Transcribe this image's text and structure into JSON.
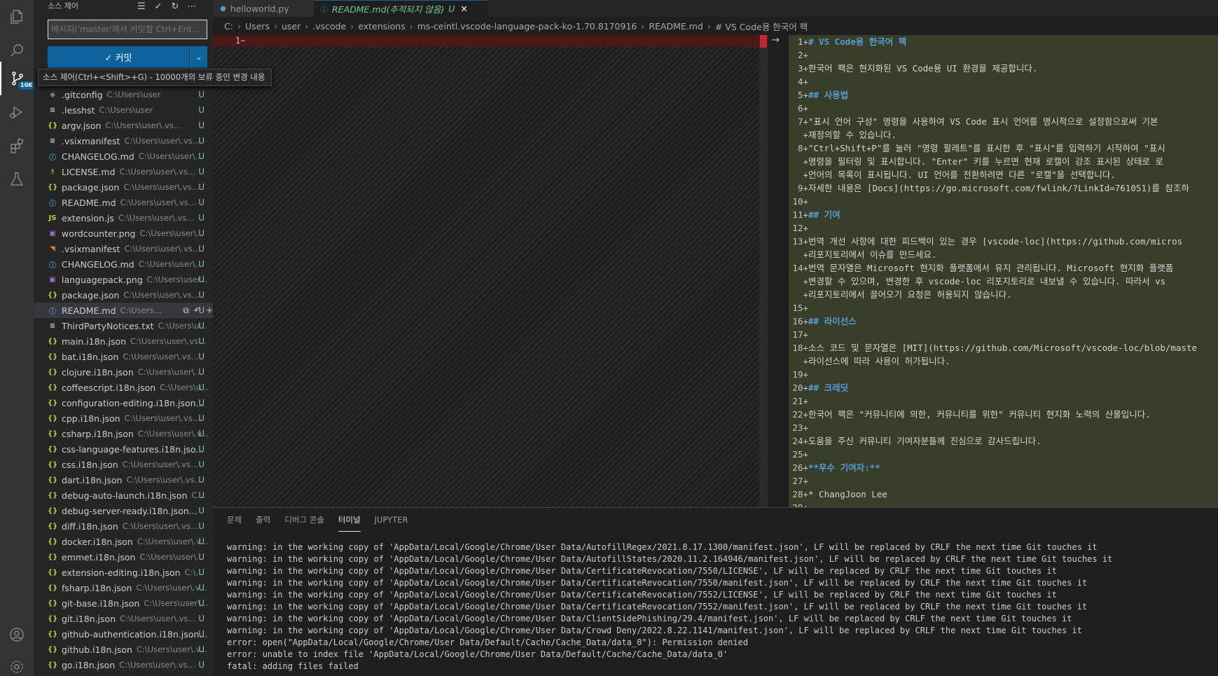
{
  "sidebar": {
    "title": "소스 제어",
    "commit_placeholder": "메시지('master'에서 커밋할 Ctrl+Ent...",
    "commit_label": "✓ 커밋",
    "tooltip": "소스 제어(Ctrl+<Shift>+G) - 10000개의 보류 중인 변경 내용",
    "badge": "10K",
    "files": [
      {
        "icon": "◆",
        "color": "#6d8086",
        "name": ".gitconfig",
        "path": "C:\\Users\\user",
        "status": "U"
      },
      {
        "icon": "≡",
        "color": "#ccc",
        "name": ".lesshst",
        "path": "C:\\Users\\user",
        "status": "U"
      },
      {
        "icon": "{}",
        "color": "#cbcb41",
        "name": "argv.json",
        "path": "C:\\Users\\user\\.vscode",
        "status": "U"
      },
      {
        "icon": "≡",
        "color": "#ccc",
        "name": ".vsixmanifest",
        "path": "C:\\Users\\user\\.vsco...",
        "status": "U"
      },
      {
        "icon": "ⓘ",
        "color": "#519aba",
        "name": "CHANGELOG.md",
        "path": "C:\\Users\\user\\...",
        "status": "U"
      },
      {
        "icon": "♗",
        "color": "#cbcb41",
        "name": "LICENSE.md",
        "path": "C:\\Users\\user\\.vscod...",
        "status": "U"
      },
      {
        "icon": "{}",
        "color": "#cbcb41",
        "name": "package.json",
        "path": "C:\\Users\\user\\.vsco...",
        "status": "U"
      },
      {
        "icon": "ⓘ",
        "color": "#519aba",
        "name": "README.md",
        "path": "C:\\Users\\user\\.vsco...",
        "status": "U"
      },
      {
        "icon": "JS",
        "color": "#cbcb41",
        "name": "extension.js",
        "path": "C:\\Users\\user\\.vscod...",
        "status": "U"
      },
      {
        "icon": "▣",
        "color": "#a074c4",
        "name": "wordcounter.png",
        "path": "C:\\Users\\user\\...",
        "status": "U"
      },
      {
        "icon": "◥",
        "color": "#e37933",
        "name": ".vsixmanifest",
        "path": "C:\\Users\\user\\.vsco...",
        "status": "U"
      },
      {
        "icon": "ⓘ",
        "color": "#519aba",
        "name": "CHANGELOG.md",
        "path": "C:\\Users\\user\\...",
        "status": "U"
      },
      {
        "icon": "▣",
        "color": "#a074c4",
        "name": "languagepack.png",
        "path": "C:\\Users\\user...",
        "status": "U"
      },
      {
        "icon": "{}",
        "color": "#cbcb41",
        "name": "package.json",
        "path": "C:\\Users\\user\\.vsco...",
        "status": "U"
      },
      {
        "icon": "ⓘ",
        "color": "#519aba",
        "name": "README.md",
        "path": "C:\\Users...",
        "status": "U",
        "selected": true
      },
      {
        "icon": "≡",
        "color": "#ccc",
        "name": "ThirdPartyNotices.txt",
        "path": "C:\\Users\\u...",
        "status": "U"
      },
      {
        "icon": "{}",
        "color": "#cbcb41",
        "name": "main.i18n.json",
        "path": "C:\\Users\\user\\.vsc...",
        "status": "U"
      },
      {
        "icon": "{}",
        "color": "#cbcb41",
        "name": "bat.i18n.json",
        "path": "C:\\Users\\user\\.vsco...",
        "status": "U"
      },
      {
        "icon": "{}",
        "color": "#cbcb41",
        "name": "clojure.i18n.json",
        "path": "C:\\Users\\user\\...",
        "status": "U"
      },
      {
        "icon": "{}",
        "color": "#cbcb41",
        "name": "coffeescript.i18n.json",
        "path": "C:\\Users\\u...",
        "status": "U"
      },
      {
        "icon": "{}",
        "color": "#cbcb41",
        "name": "configuration-editing.i18n.json...",
        "path": "",
        "status": "U"
      },
      {
        "icon": "{}",
        "color": "#cbcb41",
        "name": "cpp.i18n.json",
        "path": "C:\\Users\\user\\.vsco...",
        "status": "U"
      },
      {
        "icon": "{}",
        "color": "#cbcb41",
        "name": "csharp.i18n.json",
        "path": "C:\\Users\\user\\.v...",
        "status": "U"
      },
      {
        "icon": "{}",
        "color": "#cbcb41",
        "name": "css-language-features.i18n.jso...",
        "path": "",
        "status": "U"
      },
      {
        "icon": "{}",
        "color": "#cbcb41",
        "name": "css.i18n.json",
        "path": "C:\\Users\\user\\.vsco...",
        "status": "U"
      },
      {
        "icon": "{}",
        "color": "#cbcb41",
        "name": "dart.i18n.json",
        "path": "C:\\Users\\user\\.vsc...",
        "status": "U"
      },
      {
        "icon": "{}",
        "color": "#cbcb41",
        "name": "debug-auto-launch.i18n.json",
        "path": "C...",
        "status": "U"
      },
      {
        "icon": "{}",
        "color": "#cbcb41",
        "name": "debug-server-ready.i18n.json...",
        "path": "",
        "status": "U"
      },
      {
        "icon": "{}",
        "color": "#cbcb41",
        "name": "diff.i18n.json",
        "path": "C:\\Users\\user\\.vsco...",
        "status": "U"
      },
      {
        "icon": "{}",
        "color": "#cbcb41",
        "name": "docker.i18n.json",
        "path": "C:\\Users\\user\\.v...",
        "status": "U"
      },
      {
        "icon": "{}",
        "color": "#cbcb41",
        "name": "emmet.i18n.json",
        "path": "C:\\Users\\user\\...",
        "status": "U"
      },
      {
        "icon": "{}",
        "color": "#cbcb41",
        "name": "extension-editing.i18n.json",
        "path": "C:\\...",
        "status": "U"
      },
      {
        "icon": "{}",
        "color": "#cbcb41",
        "name": "fsharp.i18n.json",
        "path": "C:\\Users\\user\\.v...",
        "status": "U"
      },
      {
        "icon": "{}",
        "color": "#cbcb41",
        "name": "git-base.i18n.json",
        "path": "C:\\Users\\user\\...",
        "status": "U"
      },
      {
        "icon": "{}",
        "color": "#cbcb41",
        "name": "git.i18n.json",
        "path": "C:\\Users\\user\\.vscod...",
        "status": "U"
      },
      {
        "icon": "{}",
        "color": "#cbcb41",
        "name": "github-authentication.i18n.json...",
        "path": "",
        "status": "U"
      },
      {
        "icon": "{}",
        "color": "#cbcb41",
        "name": "github.i18n.json",
        "path": "C:\\Users\\user\\.v...",
        "status": "U"
      },
      {
        "icon": "{}",
        "color": "#cbcb41",
        "name": "go.i18n.json",
        "path": "C:\\Users\\user\\.vscod...",
        "status": "U"
      }
    ]
  },
  "tabs": [
    {
      "icon": "py",
      "name": "helloworld.py",
      "suffix": ""
    },
    {
      "icon": "ⓘ",
      "name": "README.md(추적되지 않음)",
      "suffix": "U"
    }
  ],
  "breadcrumb": [
    "C:",
    "Users",
    "user",
    ".vscode",
    "extensions",
    "ms-ceintl.vscode-language-pack-ko-1.70.8170916",
    "README.md",
    "# VS Code용 한국어 팩"
  ],
  "left_line": "1−",
  "code_lines": [
    {
      "n": "1+",
      "t": "# VS Code용 한국어 팩",
      "c": "h"
    },
    {
      "n": "2+",
      "t": ""
    },
    {
      "n": "3+",
      "t": "한국어 팩은 현지화된 VS Code용 UI 환경을 제공합니다."
    },
    {
      "n": "4+",
      "t": ""
    },
    {
      "n": "5+",
      "t": "## 사용법",
      "c": "h"
    },
    {
      "n": "6+",
      "t": ""
    },
    {
      "n": "7+",
      "t": "\"표시 언어 구성\" 명령을 사용하여 VS Code 표시 언어를 명시적으로 설정함으로써 기본"
    },
    {
      "n": "+",
      "t": "재정의할 수 있습니다."
    },
    {
      "n": "8+",
      "t": "\"Ctrl+Shift+P\"를 눌러 \"명령 팔레트\"를 표시한 후 \"표시\"를 입력하기 시작하여 \"표시"
    },
    {
      "n": "+",
      "t": "명령을 필터링 및 표시합니다. \"Enter\" 키를 누르면 현재 로캘이 강조 표시된 상태로 로"
    },
    {
      "n": "+",
      "t": "언어의 목록이 표시됩니다. UI 언어를 전환하려면 다른 \"로캘\"을 선택합니다."
    },
    {
      "n": "9+",
      "t": "자세한 내용은 [Docs](https://go.microsoft.com/fwlink/?LinkId=761051)를 참조하"
    },
    {
      "n": "10+",
      "t": ""
    },
    {
      "n": "11+",
      "t": "## 기여",
      "c": "h"
    },
    {
      "n": "12+",
      "t": ""
    },
    {
      "n": "13+",
      "t": "번역 개선 사항에 대한 피드백이 있는 경우 [vscode-loc](https://github.com/micros"
    },
    {
      "n": "+",
      "t": "리포지토리에서 이슈를 만드세요."
    },
    {
      "n": "14+",
      "t": "번역 문자열은 Microsoft 현지화 플랫폼에서 유지 관리됩니다. Microsoft 현지화 플랫폼"
    },
    {
      "n": "+",
      "t": "변경할 수 있으며, 변경한 후 vscode-loc 리포지토리로 내보낼 수 있습니다. 따라서 vs"
    },
    {
      "n": "+",
      "t": "리포지토리에서 끌어오기 요청은 허용되지 않습니다."
    },
    {
      "n": "15+",
      "t": ""
    },
    {
      "n": "16+",
      "t": "## 라이선스",
      "c": "h"
    },
    {
      "n": "17+",
      "t": ""
    },
    {
      "n": "18+",
      "t": "소스 코드 및 문자열은 [MIT](https://github.com/Microsoft/vscode-loc/blob/maste"
    },
    {
      "n": "+",
      "t": "라이선스에 따라 사용이 허가됩니다."
    },
    {
      "n": "19+",
      "t": ""
    },
    {
      "n": "20+",
      "t": "## 크레딧",
      "c": "h"
    },
    {
      "n": "21+",
      "t": ""
    },
    {
      "n": "22+",
      "t": "한국어 팩은 \"커뮤니티에 의한, 커뮤니티를 위한\" 커뮤니티 현지화 노력의 산물입니다."
    },
    {
      "n": "23+",
      "t": ""
    },
    {
      "n": "24+",
      "t": "도움을 주신 커뮤니티 기여자분들께 진심으로 감사드립니다."
    },
    {
      "n": "25+",
      "t": ""
    },
    {
      "n": "26+",
      "t": "**우수 기여자:**",
      "c": "h"
    },
    {
      "n": "27+",
      "t": ""
    },
    {
      "n": "28+",
      "t": "* ChangJoon Lee"
    },
    {
      "n": "29+",
      "t": ""
    }
  ],
  "panel": {
    "tabs": [
      "문제",
      "출력",
      "디버그 콘솔",
      "터미널",
      "JUPYTER"
    ],
    "active_tab": "터미널",
    "terminal": "warning: in the working copy of 'AppData/Local/Google/Chrome/User Data/AutofillRegex/2021.8.17.1300/manifest.json', LF will be replaced by CRLF the next time Git touches it\nwarning: in the working copy of 'AppData/Local/Google/Chrome/User Data/AutofillStates/2020.11.2.164946/manifest.json', LF will be replaced by CRLF the next time Git touches it\nwarning: in the working copy of 'AppData/Local/Google/Chrome/User Data/CertificateRevocation/7550/LICENSE', LF will be replaced by CRLF the next time Git touches it\nwarning: in the working copy of 'AppData/Local/Google/Chrome/User Data/CertificateRevocation/7550/manifest.json', LF will be replaced by CRLF the next time Git touches it\nwarning: in the working copy of 'AppData/Local/Google/Chrome/User Data/CertificateRevocation/7552/LICENSE', LF will be replaced by CRLF the next time Git touches it\nwarning: in the working copy of 'AppData/Local/Google/Chrome/User Data/CertificateRevocation/7552/manifest.json', LF will be replaced by CRLF the next time Git touches it\nwarning: in the working copy of 'AppData/Local/Google/Chrome/User Data/ClientSidePhishing/29.4/manifest.json', LF will be replaced by CRLF the next time Git touches it\nwarning: in the working copy of 'AppData/Local/Google/Chrome/User Data/Crowd Deny/2022.8.22.1141/manifest.json', LF will be replaced by CRLF the next time Git touches it\nerror: open(\"AppData/Local/Google/Chrome/User Data/Default/Cache/Cache_Data/data_0\"): Permission denied\nerror: unable to index file 'AppData/Local/Google/Chrome/User Data/Default/Cache/Cache_Data/data_0'\nfatal: adding files failed"
  }
}
